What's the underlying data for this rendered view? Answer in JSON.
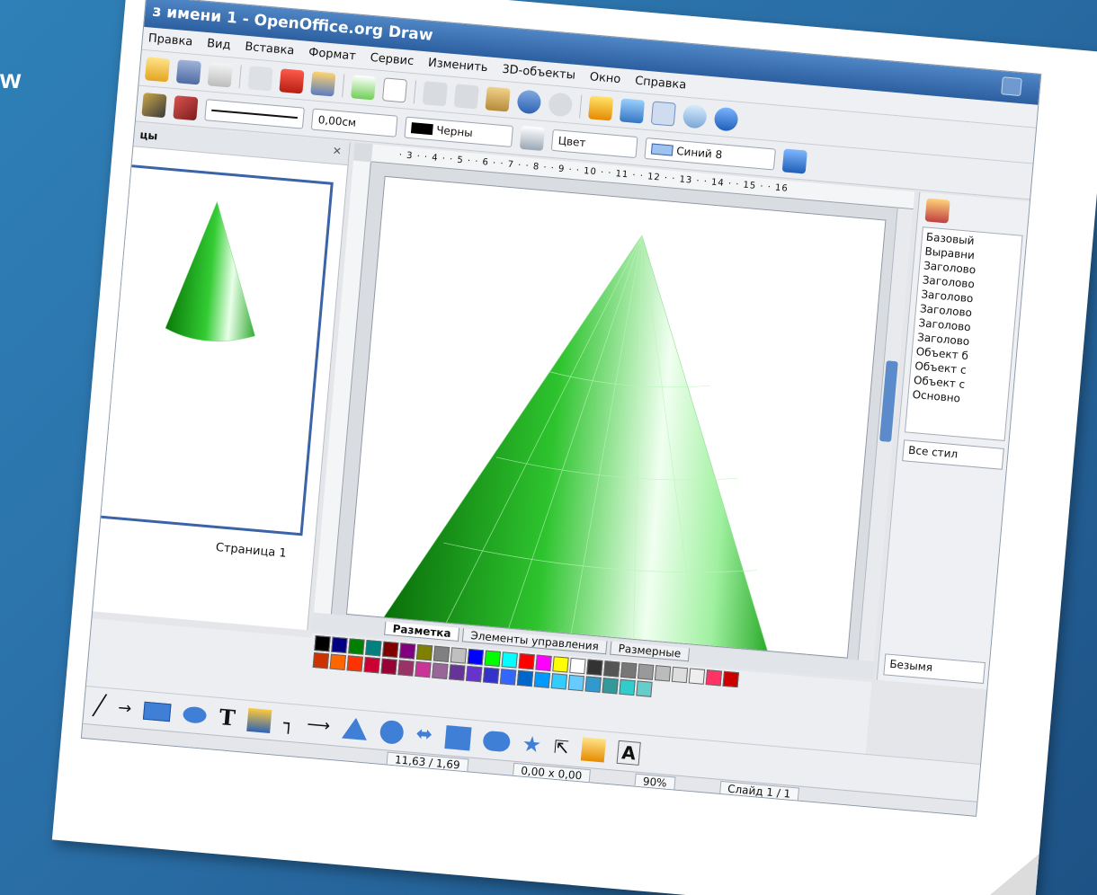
{
  "slide_fragment": "w",
  "window": {
    "title": "з имени 1 - OpenOffice.org Draw"
  },
  "menu": [
    "Правка",
    "Вид",
    "Вставка",
    "Формат",
    "Сервис",
    "Изменить",
    "3D-объекты",
    "Окно",
    "Справка"
  ],
  "line_width": "0,00см",
  "line_color": "Черны",
  "area_mode": "Цвет",
  "area_color": "Синий 8",
  "left_pane": {
    "header": "цы",
    "page_label": "Страница 1"
  },
  "ruler_h": "· 3 · · 4 · · 5 · · 6 · · 7 · · 8 · · 9 · · 10 · · 11 · · 12 · · 13 · · 14 · · 15 · · 16",
  "tabs": [
    "Разметка",
    "Элементы управления",
    "Размерные"
  ],
  "styles": [
    "Базовый",
    "Выравни",
    "Заголово",
    "Заголово",
    "Заголово",
    "Заголово",
    "Заголово",
    "Заголово",
    "Объект б",
    "Объект с",
    "Объект с",
    "Основно"
  ],
  "styles_filter": "Все стил",
  "side_bottom": "Безымя",
  "status": {
    "position": "11,63 / 1,69",
    "size": "0,00 x 0,00",
    "zoom": "90%",
    "slide": "Слайд 1 / 1"
  },
  "palette_colors_row1": [
    "#000000",
    "#000080",
    "#008000",
    "#008080",
    "#800000",
    "#800080",
    "#808000",
    "#808080",
    "#c0c0c0",
    "#0000ff",
    "#00ff00",
    "#00ffff",
    "#ff0000",
    "#ff00ff",
    "#ffff00",
    "#ffffff",
    "#333333",
    "#555555",
    "#777777",
    "#999999",
    "#bbbbbb",
    "#dddddd",
    "#eeeeee",
    "#ff3366",
    "#cc0000"
  ],
  "palette_colors_row2": [
    "#cc3300",
    "#ff6600",
    "#ff3300",
    "#cc0033",
    "#990033",
    "#993366",
    "#cc3399",
    "#996699",
    "#663399",
    "#6633cc",
    "#3333cc",
    "#3366ff",
    "#0066cc",
    "#0099ff",
    "#33ccff",
    "#66ccff",
    "#3399cc",
    "#339999",
    "#33cccc",
    "#66cccc"
  ],
  "colors": {
    "cone_light": "#e8ffe8",
    "cone_mid": "#33cc33",
    "cone_dark": "#0a7a0a",
    "accent": "#3a63a8"
  }
}
